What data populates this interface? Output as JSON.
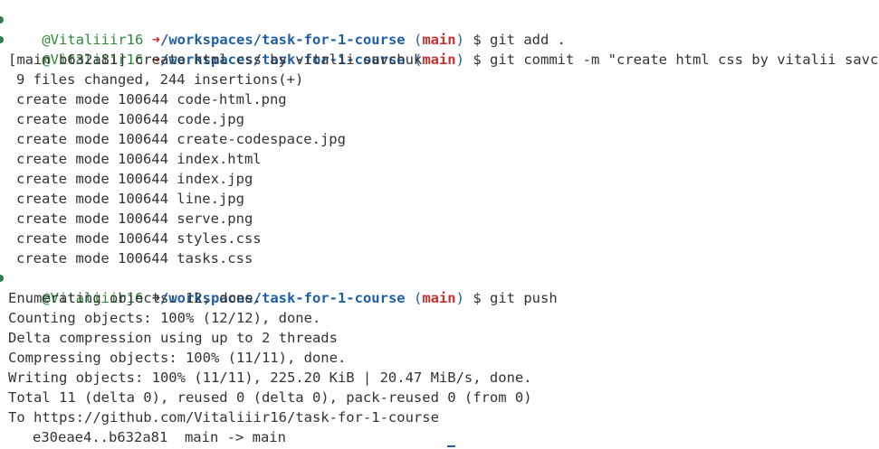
{
  "terminal": {
    "user": "@Vitaliiir16",
    "arrow": "➜",
    "path": "/workspaces/task-for-1-course",
    "branch_open": "(",
    "branch": "main",
    "branch_close": ")",
    "prompt_symbol": "$",
    "commands": {
      "add": "git add .",
      "commit": "git commit -m \"create html css by vitalii savchuk\"",
      "push": "git push"
    },
    "commit_output": [
      "[main b632a81] create html css by vitalii savchuk",
      "9 files changed, 244 insertions(+)",
      "create mode 100644 code-html.png",
      "create mode 100644 code.jpg",
      "create mode 100644 create-codespace.jpg",
      "create mode 100644 index.html",
      "create mode 100644 index.jpg",
      "create mode 100644 line.jpg",
      "create mode 100644 serve.png",
      "create mode 100644 styles.css",
      "create mode 100644 tasks.css"
    ],
    "push_output": [
      "Enumerating objects: 12, done.",
      "Counting objects: 100% (12/12), done.",
      "Delta compression using up to 2 threads",
      "Compressing objects: 100% (11/11), done.",
      "Writing objects: 100% (11/11), 225.20 KiB | 20.47 MiB/s, done.",
      "Total 11 (delta 0), reused 0 (delta 0), pack-reused 0 (from 0)",
      "To https://github.com/Vitaliiir16/task-for-1-course",
      "e30eae4..b632a81  main -> main"
    ]
  }
}
